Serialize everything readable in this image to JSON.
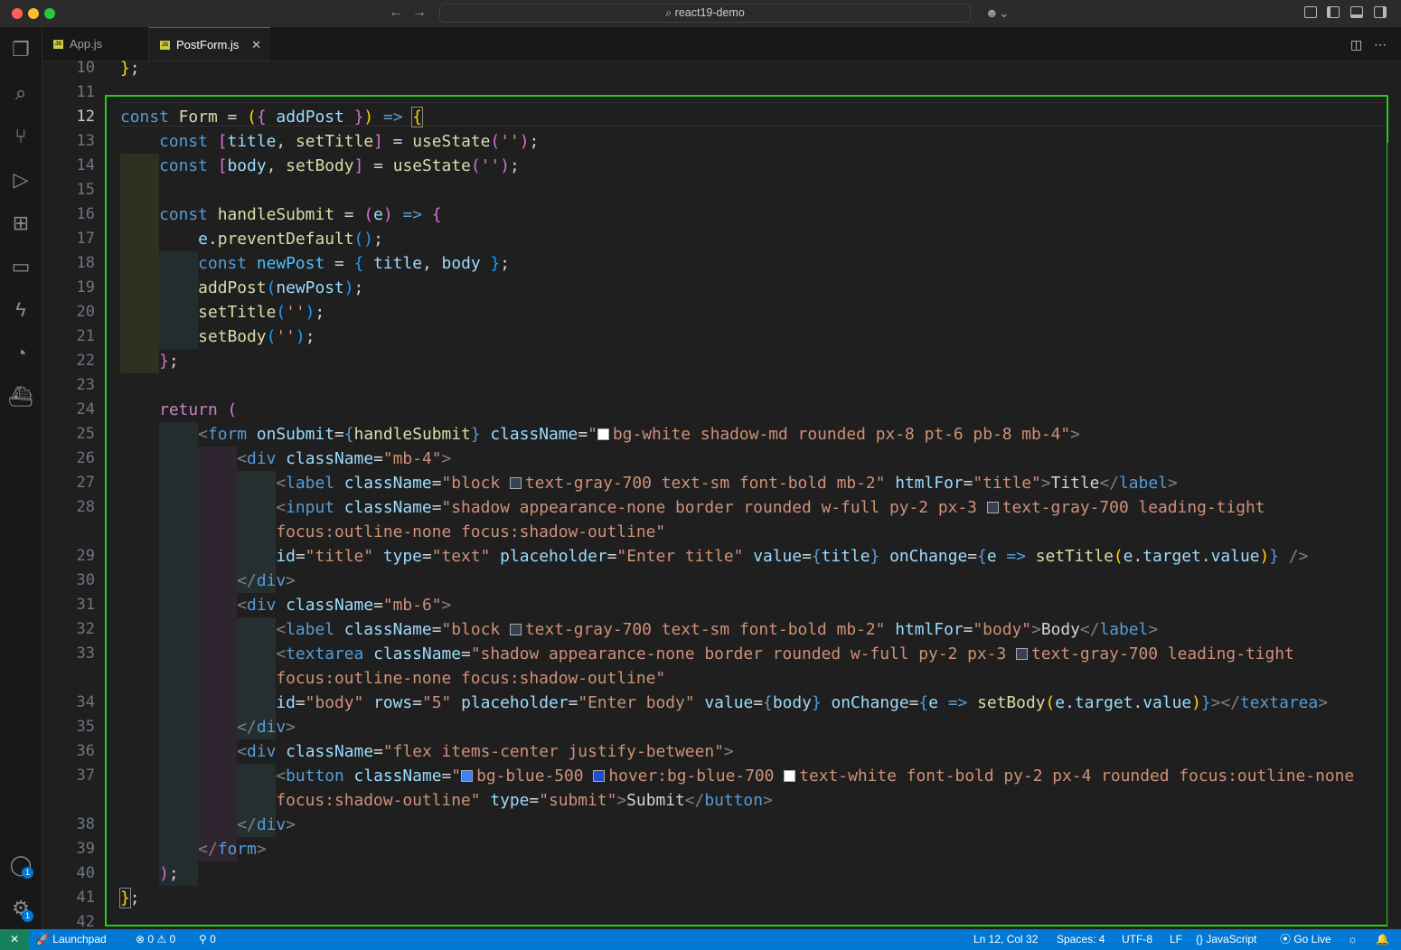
{
  "window": {
    "command_center_text": "react19-demo"
  },
  "tabs": [
    {
      "label": "App.js",
      "active": false
    },
    {
      "label": "PostForm.js",
      "active": true
    }
  ],
  "activity_bar": [
    "files-icon",
    "search-icon",
    "source-control-icon",
    "run-debug-icon",
    "extensions-icon",
    "remote-explorer-icon",
    "thunder-icon",
    "gitlens-icon",
    "docker-icon"
  ],
  "accounts_badge": "1",
  "settings_badge": "1",
  "editor": {
    "active_line": 12,
    "line_numbers": [
      "10",
      "11",
      "12",
      "13",
      "14",
      "15",
      "16",
      "17",
      "18",
      "19",
      "20",
      "21",
      "22",
      "23",
      "24",
      "25",
      "26",
      "27",
      "28",
      "",
      "29",
      "30",
      "31",
      "32",
      "33",
      "",
      "34",
      "35",
      "36",
      "37",
      "",
      "38",
      "39",
      "40",
      "41",
      "42"
    ]
  },
  "status_bar": {
    "launchpad": "Launchpad",
    "errors": "0",
    "warnings": "0",
    "ports": "0",
    "cursor": "Ln 12, Col 32",
    "spaces": "Spaces: 4",
    "encoding": "UTF-8",
    "eol": "LF",
    "language": "JavaScript",
    "go_live": "Go Live"
  }
}
